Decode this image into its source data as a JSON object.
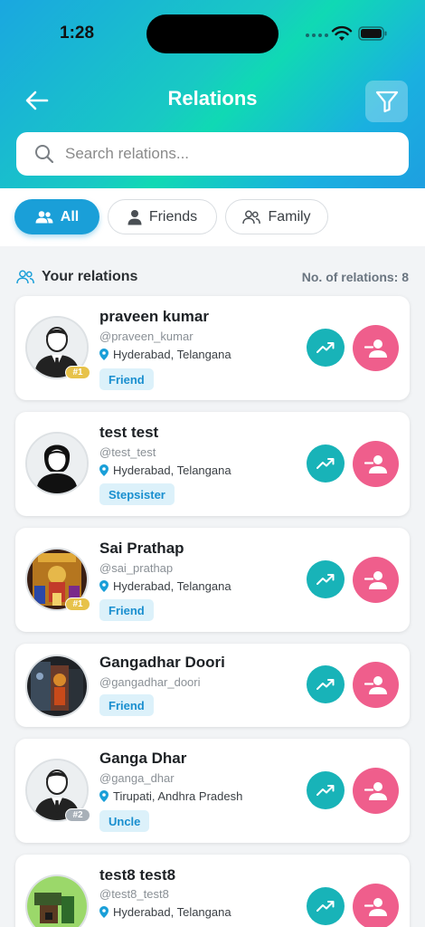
{
  "status_bar": {
    "time": "1:28"
  },
  "header": {
    "title": "Relations"
  },
  "search": {
    "placeholder": "Search relations..."
  },
  "tabs": [
    {
      "label": "All",
      "active": true
    },
    {
      "label": "Friends",
      "active": false
    },
    {
      "label": "Family",
      "active": false
    }
  ],
  "section": {
    "title": "Your relations",
    "count_text": "No. of relations: 8"
  },
  "relations": [
    {
      "name": "praveen kumar",
      "handle": "@praveen_kumar",
      "location": "Hyderabad, Telangana",
      "relation": "Friend",
      "rank": "#1",
      "avatar": "default-male-avatar"
    },
    {
      "name": "test test",
      "handle": "@test_test",
      "location": "Hyderabad, Telangana",
      "relation": "Stepsister",
      "rank": "",
      "avatar": "default-female-avatar"
    },
    {
      "name": "Sai Prathap",
      "handle": "@sai_prathap",
      "location": "Hyderabad, Telangana",
      "relation": "Friend",
      "rank": "#1",
      "avatar": "photo-temple"
    },
    {
      "name": "Gangadhar Doori",
      "handle": "@gangadhar_doori",
      "location": "",
      "relation": "Friend",
      "rank": "",
      "avatar": "photo-shrine"
    },
    {
      "name": "Ganga Dhar",
      "handle": "@ganga_dhar",
      "location": "Tirupati, Andhra Pradesh",
      "relation": "Uncle",
      "rank": "#2",
      "avatar": "default-male-avatar"
    },
    {
      "name": "test8  test8",
      "handle": "@test8_test8",
      "location": "Hyderabad, Telangana",
      "relation": "",
      "rank": "",
      "avatar": "photo-pixel"
    }
  ],
  "colors": {
    "accent": "#1a9fd8",
    "trend": "#18b3b8",
    "remove": "#ef5e8c",
    "tag_bg": "#dcf1fa",
    "rank_gold": "#e7c24a"
  }
}
